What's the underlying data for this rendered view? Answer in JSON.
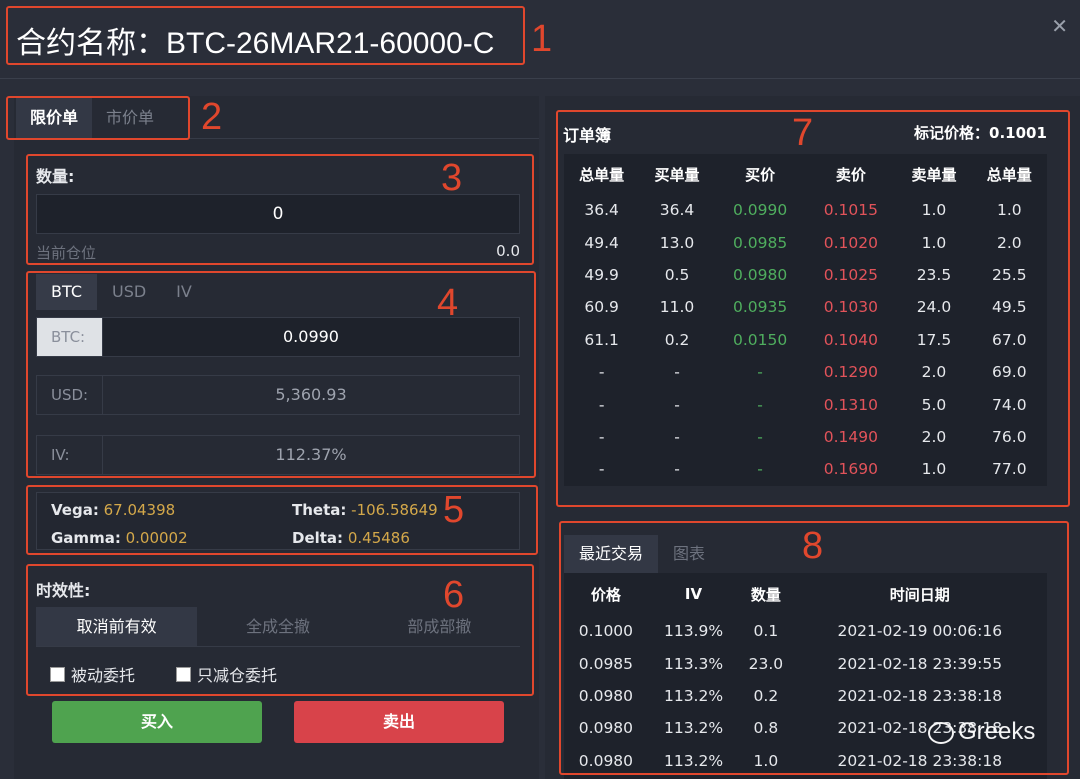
{
  "header": {
    "title": "合约名称：BTC-26MAR21-60000-C",
    "close_icon": "close-icon"
  },
  "order_type_tabs": [
    "限价单",
    "市价单"
  ],
  "quantity": {
    "label": "数量:",
    "value": "0",
    "position_label": "当前仓位",
    "position_value": "0.0"
  },
  "unit_tabs": [
    "BTC",
    "USD",
    "IV"
  ],
  "price_fields": {
    "btc_label": "BTC:",
    "btc_value": "0.0990",
    "usd_label": "USD:",
    "usd_value": "5,360.93",
    "iv_label": "IV:",
    "iv_value": "112.37%"
  },
  "greeks": {
    "vega_label": "Vega:",
    "vega": "67.04398",
    "theta_label": "Theta:",
    "theta": "-106.58649",
    "gamma_label": "Gamma:",
    "gamma": "0.00002",
    "delta_label": "Delta:",
    "delta": "0.45486"
  },
  "time_in_force": {
    "label": "时效性:",
    "options": [
      "取消前有效",
      "全成全撤",
      "部成部撤"
    ],
    "post_only": "被动委托",
    "reduce_only": "只减仓委托"
  },
  "actions": {
    "buy": "买入",
    "sell": "卖出"
  },
  "orderbook": {
    "title": "订单簿",
    "mark_price": "标记价格：0.1001",
    "headers": [
      "总单量",
      "买单量",
      "买价",
      "卖价",
      "卖单量",
      "总单量"
    ],
    "rows": [
      [
        "36.4",
        "36.4",
        "0.0990",
        "0.1015",
        "1.0",
        "1.0"
      ],
      [
        "49.4",
        "13.0",
        "0.0985",
        "0.1020",
        "1.0",
        "2.0"
      ],
      [
        "49.9",
        "0.5",
        "0.0980",
        "0.1025",
        "23.5",
        "25.5"
      ],
      [
        "60.9",
        "11.0",
        "0.0935",
        "0.1030",
        "24.0",
        "49.5"
      ],
      [
        "61.1",
        "0.2",
        "0.0150",
        "0.1040",
        "17.5",
        "67.0"
      ],
      [
        "-",
        "-",
        "-",
        "0.1290",
        "2.0",
        "69.0"
      ],
      [
        "-",
        "-",
        "-",
        "0.1310",
        "5.0",
        "74.0"
      ],
      [
        "-",
        "-",
        "-",
        "0.1490",
        "2.0",
        "76.0"
      ],
      [
        "-",
        "-",
        "-",
        "0.1690",
        "1.0",
        "77.0"
      ]
    ]
  },
  "recent_trades": {
    "tabs": [
      "最近交易",
      "图表"
    ],
    "headers": [
      "价格",
      "IV",
      "数量",
      "时间日期"
    ],
    "rows": [
      [
        "0.1000",
        "113.9%",
        "0.1",
        "2021-02-19 00:06:16"
      ],
      [
        "0.0985",
        "113.3%",
        "23.0",
        "2021-02-18 23:39:55"
      ],
      [
        "0.0980",
        "113.2%",
        "0.2",
        "2021-02-18 23:38:18"
      ],
      [
        "0.0980",
        "113.2%",
        "0.8",
        "2021-02-18 23:38:18"
      ],
      [
        "0.0980",
        "113.2%",
        "1.0",
        "2021-02-18 23:38:18"
      ]
    ]
  },
  "annotations": [
    "1",
    "2",
    "3",
    "4",
    "5",
    "6",
    "7",
    "8"
  ],
  "watermark": "Greeks",
  "colors": {
    "accent_red": "#e0472d",
    "bid_green": "#4fae5e",
    "ask_red": "#e2535a",
    "greek_value": "#d4a84a",
    "buy_button": "#4fa34f",
    "sell_button": "#d8434a"
  }
}
